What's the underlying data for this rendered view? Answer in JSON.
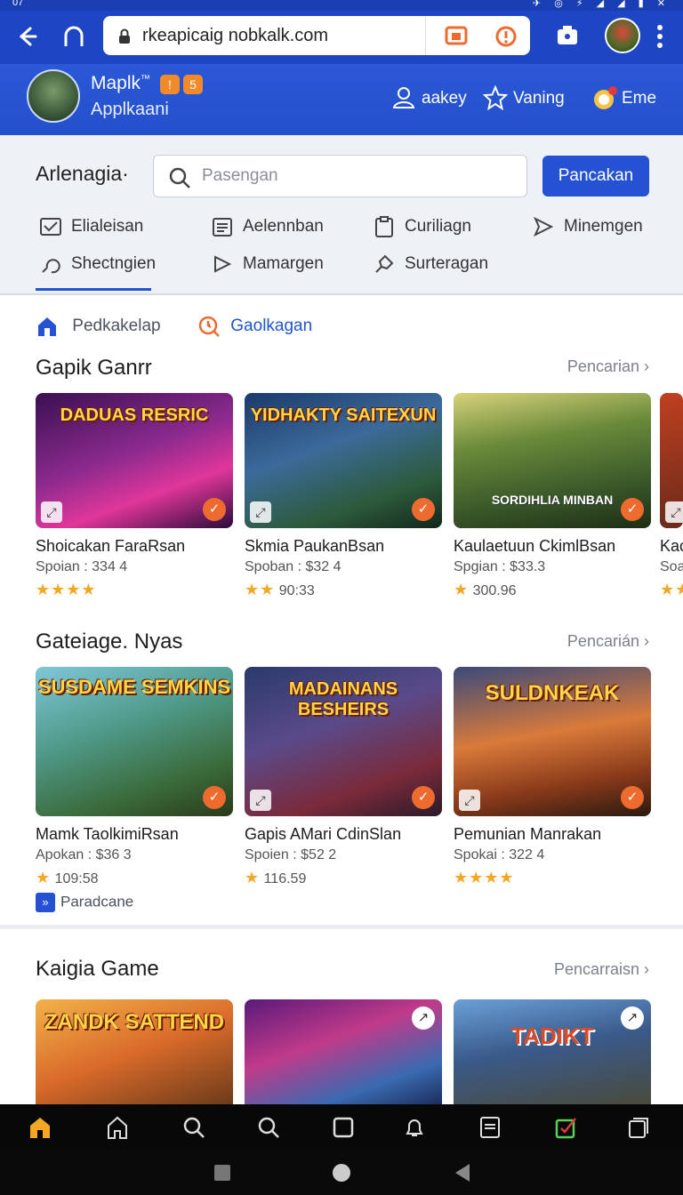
{
  "status": {
    "time": "07",
    "icons": "✈ ◎ ⚡ ◢ ◢ ▮ ✕"
  },
  "browser": {
    "url": "rkeapicaig nobkalk.com",
    "back_icon": "back-arrow-icon",
    "home_icon": "home-icon",
    "tab_icon": "tabs-icon",
    "menu_icon": "more-vertical-icon"
  },
  "profile": {
    "name": "Maplk",
    "name_sup": "™",
    "subtitle": "Applkaani",
    "badges": [
      "!",
      "5"
    ],
    "links": [
      {
        "label": "aakey",
        "icon": "user-icon"
      },
      {
        "label": "Vaning",
        "icon": "star-icon"
      },
      {
        "label": "Eme",
        "icon": "chat-icon"
      }
    ]
  },
  "search": {
    "label": "Arlenagia·",
    "placeholder": "Pasengan",
    "button": "Pancakan"
  },
  "categories": [
    {
      "label": "Elialeisan",
      "icon": "mail-icon"
    },
    {
      "label": "Aelennban",
      "icon": "calendar-icon"
    },
    {
      "label": "Curiliagn",
      "icon": "clipboard-icon"
    },
    {
      "label": "Minemgen",
      "icon": "send-icon"
    },
    {
      "label": "Shectngien",
      "icon": "tag-icon"
    },
    {
      "label": "Mamargen",
      "icon": "pencil-icon"
    },
    {
      "label": "Surteragan",
      "icon": "puzzle-icon"
    }
  ],
  "subtabs": [
    {
      "label": "Pedkakelap",
      "color": "#4d5360"
    },
    {
      "label": "Gaolkagan",
      "color": "#1f56c9"
    }
  ],
  "sections": [
    {
      "title": "Gapik Ganrr",
      "more": "Pencarian",
      "games": [
        {
          "art": "DADUAS RESRIC",
          "name": "Shoicakan FaraRsan",
          "price": "Spoian : 334 4",
          "stars": "★★★★",
          "score": ""
        },
        {
          "art": "YIDHAKTY SAITEXUN",
          "name": "Skmia PaukanBsan",
          "price": "Spoban : $32 4",
          "stars": "★★",
          "score": "90:33"
        },
        {
          "art": "SORDIHLIA MINBAN",
          "name": "Kaulaetuun CkimlBsan",
          "price": "Spgian : $33.3",
          "stars": "★",
          "score": "300.96"
        },
        {
          "art": "",
          "name": "Kac",
          "price": "Soa",
          "stars": "★★",
          "score": ""
        }
      ]
    },
    {
      "title": "Gateiage. Nyas",
      "more": "Pencarián",
      "games": [
        {
          "art": "SUSDAME SEMKINS",
          "name": "Mamk TaolkimiRsan",
          "price": "Apokan : $36 3",
          "stars": "★",
          "score": "109:58"
        },
        {
          "art": "MADAINANS BESHEIRS",
          "name": "Gapis AMari CdinSlan",
          "price": "Spoien : $52 2",
          "stars": "★",
          "score": "116.59"
        },
        {
          "art": "SULDNKEAK",
          "name": "Pemunian Manrakan",
          "price": "Spokai : 322 4",
          "stars": "★★★★",
          "score": ""
        }
      ]
    },
    {
      "title": "Kaigia Game",
      "more": "Pencarraisn",
      "games": [
        {
          "art": "ZANDK SATTEND"
        },
        {
          "art": ""
        },
        {
          "art": "TADIKT"
        }
      ]
    }
  ],
  "paradcane": {
    "icon": "»",
    "label": "Paradcane"
  },
  "bottom_nav": [
    "home-filled-icon",
    "home-icon",
    "search-icon",
    "search-icon-2",
    "square-icon",
    "bell-icon",
    "list-icon",
    "edit-check-icon",
    "copy-icon"
  ],
  "colors": {
    "brand": "#1d45c4",
    "accent": "#2452d3",
    "orange": "#ee6b2f",
    "star": "#f5a623"
  }
}
